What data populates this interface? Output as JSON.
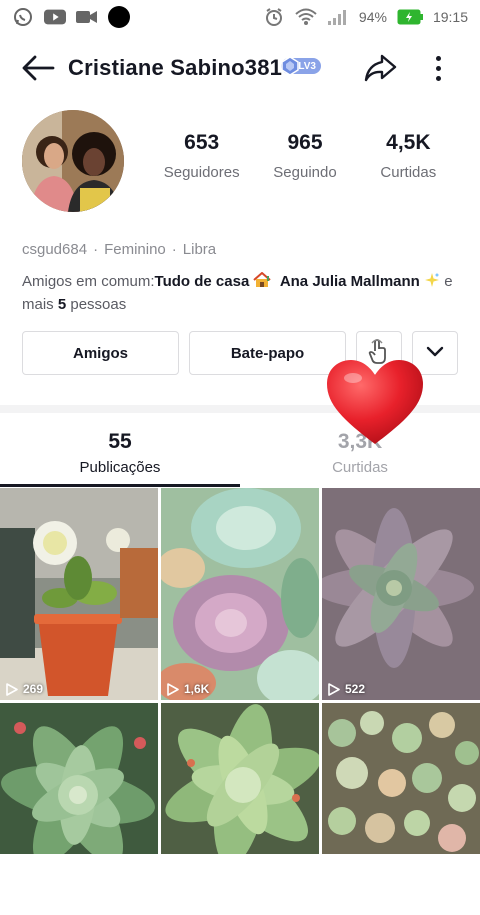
{
  "status_bar": {
    "battery": "94%",
    "time": "19:15"
  },
  "header": {
    "back_icon": "arrow-left-icon",
    "title": "Cristiane Sabino381",
    "level_badge": "LV3",
    "share_icon": "share-icon",
    "more_icon": "more-vertical-icon"
  },
  "profile": {
    "stats": [
      {
        "value": "653",
        "label": "Seguidores"
      },
      {
        "value": "965",
        "label": "Seguindo"
      },
      {
        "value": "4,5K",
        "label": "Curtidas"
      }
    ],
    "meta": {
      "username": "csgud684",
      "gender": "Feminino",
      "sign": "Libra"
    },
    "mutual": {
      "prefix": "Amigos em comum:",
      "friend1": "Tudo de casa",
      "friend2": "Ana Julia Mallmann",
      "middle": " e mais ",
      "count": "5",
      "suffix": " pessoas"
    }
  },
  "actions": {
    "friends_label": "Amigos",
    "chat_label": "Bate-papo",
    "poke_icon": "poke-hand-icon",
    "dropdown_icon": "chevron-down-icon"
  },
  "tabs": [
    {
      "count": "55",
      "label": "Publicações"
    },
    {
      "count": "3,3K",
      "label": "Curtidas"
    }
  ],
  "posts": [
    {
      "views": "269"
    },
    {
      "views": "1,6K"
    },
    {
      "views": "522"
    },
    {
      "views": ""
    },
    {
      "views": ""
    },
    {
      "views": ""
    }
  ],
  "colors": {
    "text": "#161823",
    "secondary": "#6d6e75",
    "badge": "#8aa3e8",
    "heart": "#e8212b"
  }
}
